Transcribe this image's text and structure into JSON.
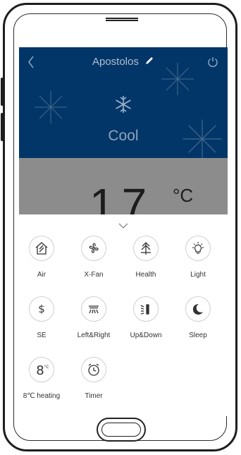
{
  "header": {
    "title": "Apostolos"
  },
  "mode": {
    "label": "Cool",
    "icon": "snowflake-icon"
  },
  "temperature": {
    "value": "17",
    "unit": "°C"
  },
  "functions": [
    {
      "label": "Air",
      "icon": "air-house-icon"
    },
    {
      "label": "X-Fan",
      "icon": "fan-icon"
    },
    {
      "label": "Health",
      "icon": "pine-tree-icon"
    },
    {
      "label": "Light",
      "icon": "lightbulb-icon"
    },
    {
      "label": "SE",
      "icon": "dollar-icon"
    },
    {
      "label": "Left&Right",
      "icon": "swing-left-right-icon"
    },
    {
      "label": "Up&Down",
      "icon": "swing-up-down-icon"
    },
    {
      "label": "Sleep",
      "icon": "moon-stars-icon"
    },
    {
      "label": "8℃ heating",
      "icon": "eight-degree-icon"
    },
    {
      "label": "Timer",
      "icon": "alarm-clock-icon"
    }
  ],
  "colors": {
    "header_bg": "#033668",
    "temp_bg": "#8c8c8c",
    "accent": "#333333"
  }
}
